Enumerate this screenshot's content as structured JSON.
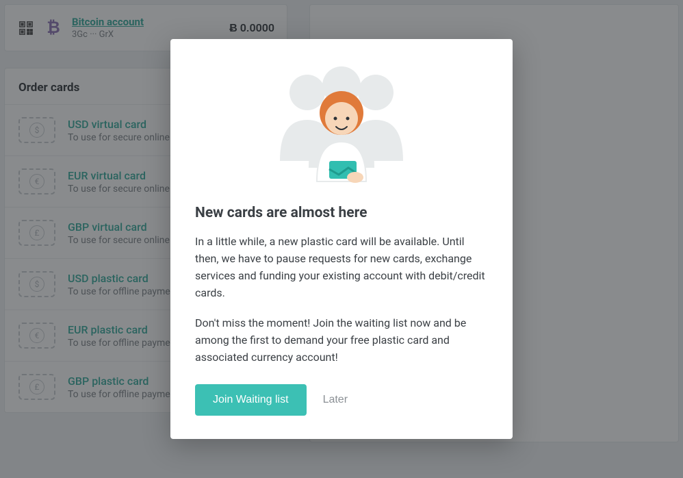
{
  "account": {
    "name": "Bitcoin account",
    "address_masked": "3Gc ··· GrX",
    "balance": "Ƀ 0.0000"
  },
  "order_section": {
    "title": "Order cards",
    "cards": [
      {
        "currency": "$",
        "title": "USD virtual card",
        "sub": "To use for secure online payments"
      },
      {
        "currency": "€",
        "title": "EUR virtual card",
        "sub": "To use for secure online payments"
      },
      {
        "currency": "£",
        "title": "GBP virtual card",
        "sub": "To use for secure online payments"
      },
      {
        "currency": "$",
        "title": "USD plastic card",
        "sub": "To use for offline payments and ATMs"
      },
      {
        "currency": "€",
        "title": "EUR plastic card",
        "sub": "To use for offline payments and ATMs"
      },
      {
        "currency": "£",
        "title": "GBP plastic card",
        "sub": "To use for offline payments and ATMs"
      }
    ]
  },
  "modal": {
    "title": "New cards are almost here",
    "p1": "In a little while, a new plastic card will be available. Until then, we have to pause requests for new cards, exchange services and funding your existing account with debit/credit cards.",
    "p2": "Don't miss the moment! Join the waiting list now and be among the first to demand your free plastic card and associated currency account!",
    "primary": "Join Waiting list",
    "secondary": "Later"
  }
}
